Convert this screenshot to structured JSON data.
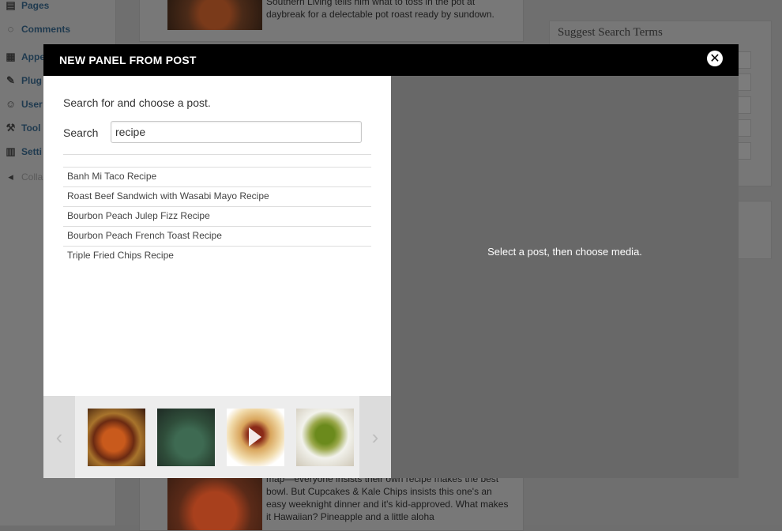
{
  "wp_menu": {
    "items": [
      {
        "label": "Pages",
        "icon": "pages-icon"
      },
      {
        "label": "Comments",
        "icon": "comments-icon"
      },
      {
        "label": "Appe",
        "icon": "appearance-icon"
      },
      {
        "label": "Plug",
        "icon": "plugins-icon"
      },
      {
        "label": "User",
        "icon": "users-icon"
      },
      {
        "label": "Tool",
        "icon": "tools-icon"
      },
      {
        "label": "Setti",
        "icon": "settings-icon"
      },
      {
        "label": "Colla",
        "icon": "collapse-icon"
      }
    ]
  },
  "background_posts": {
    "top_excerpt": "Southern Living tells him what to toss in the pot at daybreak for a delectable pot roast ready by sundown.",
    "bottom_excerpt": "map—everyone insists their own recipe makes the best bowl. But Cupcakes & Kale Chips insists this one's an easy weeknight dinner and it's kid-approved. What makes it Hawaiian? Pineapple and a little aloha"
  },
  "widget": {
    "suggest_title": "Suggest Search Terms"
  },
  "modal": {
    "title": "NEW PANEL FROM POST",
    "close_glyph": "✕",
    "instruction": "Search for and choose a post.",
    "search_label": "Search",
    "search_value": "recipe",
    "results": [
      "Banh Mi Taco Recipe",
      "Roast Beef Sandwich with Wasabi Mayo Recipe",
      "Bourbon Peach Julep Fizz Recipe",
      "Bourbon Peach French Toast Recipe",
      "Triple Fried Chips Recipe"
    ],
    "right_hint": "Select a post, then choose media.",
    "carousel": {
      "prev_glyph": "‹",
      "next_glyph": "›",
      "thumbnails": [
        {
          "name": "stew-bowl",
          "video": false
        },
        {
          "name": "green-plate",
          "video": false
        },
        {
          "name": "pasta-plate",
          "video": true
        },
        {
          "name": "soup-bowl",
          "video": false
        }
      ]
    }
  },
  "colors": {
    "overlay": "#686868",
    "header": "#000000",
    "panel": "#ffffff"
  }
}
